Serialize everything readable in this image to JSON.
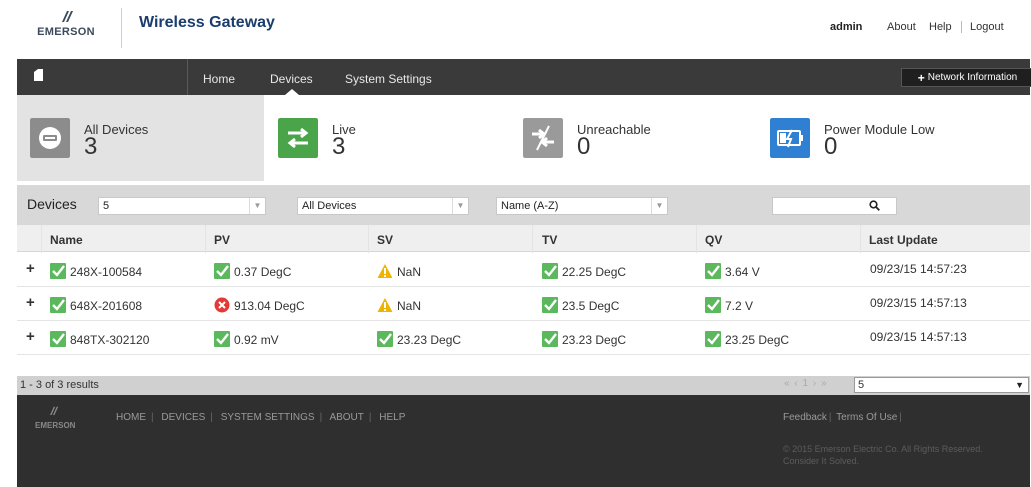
{
  "header": {
    "brand": "EMERSON",
    "title": "Wireless Gateway",
    "user": "admin",
    "links": [
      "About",
      "Help",
      "Logout"
    ]
  },
  "nav": {
    "items": [
      "Home",
      "Devices",
      "System Settings"
    ],
    "active": "Devices",
    "network_button": "Network Information"
  },
  "summary": [
    {
      "label": "All Devices",
      "count": "3",
      "icon": "device-icon",
      "color": "#8c8c8c"
    },
    {
      "label": "Live",
      "count": "3",
      "icon": "swap-arrows-icon",
      "color": "#4aa54a"
    },
    {
      "label": "Unreachable",
      "count": "0",
      "icon": "broken-link-icon",
      "color": "#9a9a9a"
    },
    {
      "label": "Power Module Low",
      "count": "0",
      "icon": "battery-low-icon",
      "color": "#2f7fd3"
    }
  ],
  "toolbar": {
    "title": "Devices",
    "per_page": "5",
    "filter": "All Devices",
    "sort": "Name (A-Z)",
    "search_value": ""
  },
  "table": {
    "columns": [
      "Name",
      "PV",
      "SV",
      "TV",
      "QV",
      "Last Update"
    ],
    "rows": [
      {
        "name": "248X-100584",
        "pv": {
          "status": "ok",
          "value": "0.37  DegC"
        },
        "sv": {
          "status": "warning",
          "value": "NaN"
        },
        "tv": {
          "status": "ok",
          "value": "22.25  DegC"
        },
        "qv": {
          "status": "ok",
          "value": "3.64  V"
        },
        "updated": "09/23/15 14:57:23"
      },
      {
        "name": "648X-201608",
        "pv": {
          "status": "error",
          "value": "913.04  DegC"
        },
        "sv": {
          "status": "warning",
          "value": "NaN"
        },
        "tv": {
          "status": "ok",
          "value": "23.5  DegC"
        },
        "qv": {
          "status": "ok",
          "value": "7.2  V"
        },
        "updated": "09/23/15 14:57:13"
      },
      {
        "name": "848TX-302120",
        "pv": {
          "status": "ok",
          "value": "0.92  mV"
        },
        "sv": {
          "status": "ok",
          "value": "23.23  DegC"
        },
        "tv": {
          "status": "ok",
          "value": "23.23  DegC"
        },
        "qv": {
          "status": "ok",
          "value": "23.25  DegC"
        },
        "updated": "09/23/15 14:57:13"
      }
    ]
  },
  "pager": {
    "results": "1 - 3 of 3 results",
    "current_page": "1",
    "page_size": "5"
  },
  "footer": {
    "brand": "EMERSON",
    "links": [
      "HOME",
      "DEVICES",
      "SYSTEM SETTINGS",
      "ABOUT",
      "HELP"
    ],
    "right_links": [
      "Feedback",
      "Terms Of Use"
    ],
    "copyright": "© 2015 Emerson Electric Co. All Rights Reserved.",
    "tagline": "Consider It Solved."
  },
  "colors": {
    "ok": "#5cb85c",
    "warning": "#f0b400",
    "error": "#e53935",
    "navbar": "#3a3a3a",
    "footer": "#2f2f2f"
  }
}
